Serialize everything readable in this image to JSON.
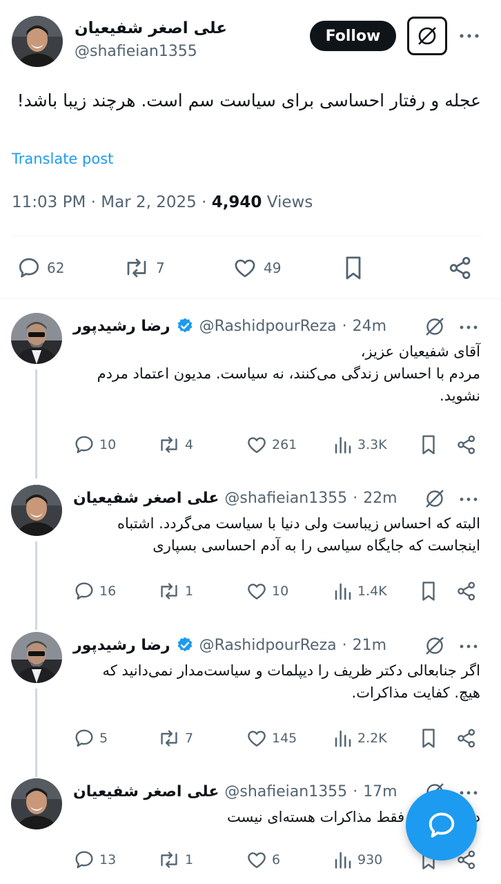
{
  "main": {
    "name": "علی اصغر شفیعیان",
    "handle": "@shafieian1355",
    "follow_label": "Follow",
    "text": "عجله و رفتار احساسی برای سیاست سم است. هرچند زیبا باشد!",
    "translate_label": "Translate post",
    "time": "11:03 PM",
    "date": "Mar 2, 2025",
    "views_count": "4,940",
    "views_label": "Views",
    "replies": "62",
    "reposts": "7",
    "likes": "49"
  },
  "replies": [
    {
      "name": "رضا رشیدپور",
      "verified": true,
      "handle": "@RashidpourReza",
      "time": "24m",
      "text": "آقای شفیعیان عزیز،\nمردم با احساس زندگی می‌کنند، نه سیاست. مدیون اعتماد مردم نشوید.",
      "replies": "10",
      "reposts": "4",
      "likes": "261",
      "views": "3.3K"
    },
    {
      "name": "علی اصغر شفیعیان",
      "verified": false,
      "handle": "@shafieian1355",
      "time": "22m",
      "text": "البته که احساس زیباست ولی دنیا با سیاست می‌گردد. اشتباه اینجاست که جایگاه سیاسی را به آدم احساسی بسپاری",
      "replies": "16",
      "reposts": "1",
      "likes": "10",
      "views": "1.4K"
    },
    {
      "name": "رضا رشیدپور",
      "verified": true,
      "handle": "@RashidpourReza",
      "time": "21m",
      "text": "اگر جنابعالی دکتر ظریف را دیپلمات و سیاست‌مدار نمی‌دانید که هیچ. کفایت مذاکرات.",
      "replies": "5",
      "reposts": "7",
      "likes": "145",
      "views": "2.2K"
    },
    {
      "name": "علی اصغر شفیعیان",
      "verified": false,
      "handle": "@shafieian1355",
      "time": "17m",
      "text": "دنیا سیاست فقط مذاکرات هسته‌ای نیست",
      "replies": "13",
      "reposts": "1",
      "likes": "6",
      "views": "930"
    }
  ],
  "colors": {
    "accent": "#1d9bf0",
    "text_primary": "#0f1419",
    "text_secondary": "#536471",
    "thread_line": "#cfd9de",
    "verified": "#1d9bf0"
  },
  "icons": {
    "reply": "reply-icon",
    "repost": "repost-icon",
    "like": "heart-icon",
    "views": "views-icon",
    "bookmark": "bookmark-icon",
    "share": "share-icon",
    "grok": "grok-icon",
    "more": "more-icon",
    "compose": "compose-icon"
  }
}
